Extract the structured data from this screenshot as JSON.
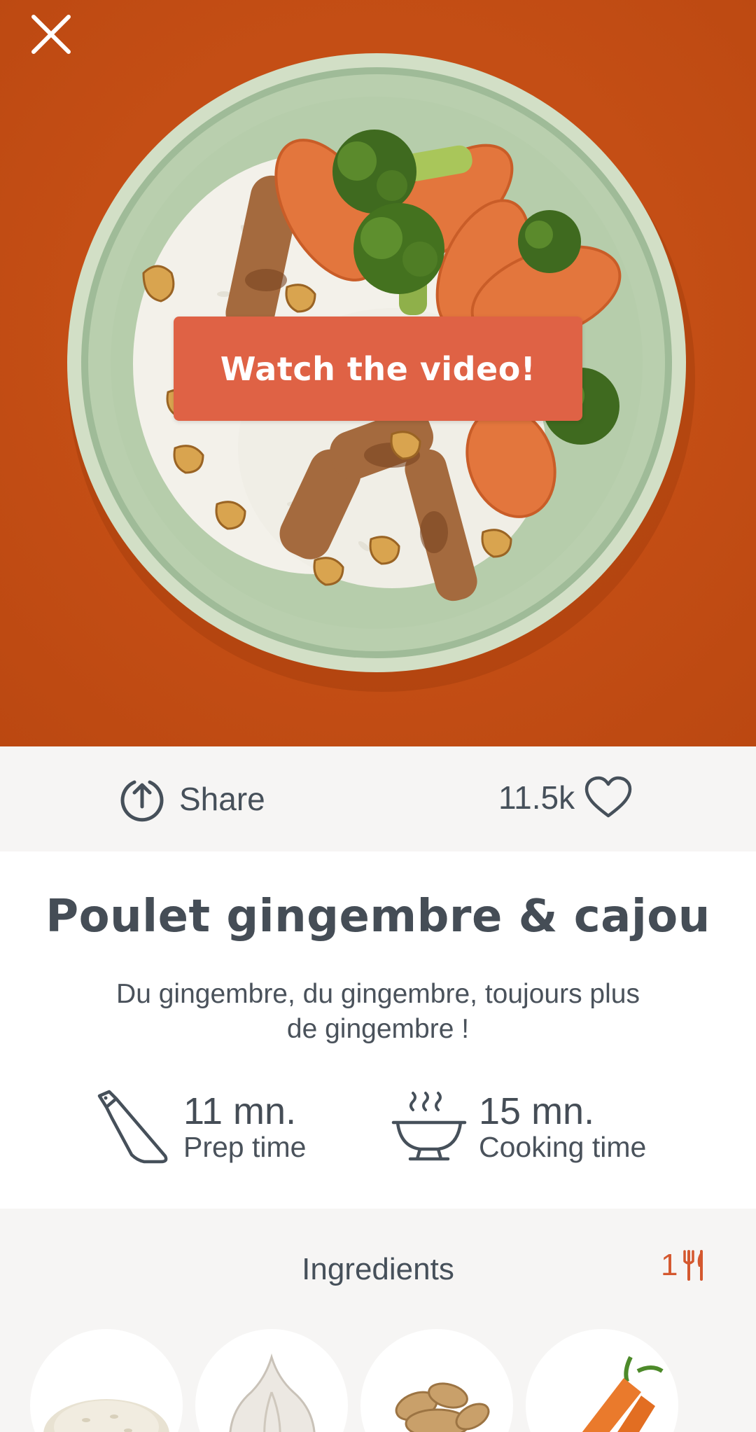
{
  "hero": {
    "watch_label": "Watch the video!",
    "close_icon": "close-icon",
    "colors": {
      "background": "#c44e15",
      "button": "#df6245"
    }
  },
  "actions": {
    "share_label": "Share",
    "share_icon": "share-icon",
    "likes": "11.5k",
    "like_icon": "heart-icon"
  },
  "recipe": {
    "title": "Poulet gingembre & cajou",
    "description_line1": "Du gingembre, du gingembre, toujours plus",
    "description_line2": "de gingembre !",
    "prep": {
      "value": "11 mn.",
      "label": "Prep time",
      "icon": "knife-icon"
    },
    "cook": {
      "value": "15 mn.",
      "label": "Cooking time",
      "icon": "steaming-bowl-icon"
    }
  },
  "ingredients": {
    "title": "Ingredients",
    "servings": "1",
    "servings_icon": "fork-knife-icon",
    "items": [
      "rice",
      "garlic",
      "ginger",
      "carrot"
    ]
  },
  "colors": {
    "text": "#46505a",
    "accent": "#d4582f",
    "panel": "#f6f5f4"
  }
}
